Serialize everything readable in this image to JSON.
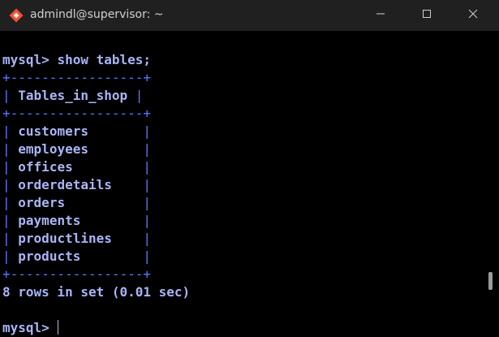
{
  "window": {
    "title": "admindl@supervisor: ~",
    "icon": "git-bash-icon"
  },
  "controls": {
    "minimize": "minimize-icon",
    "maximize": "maximize-icon",
    "close": "close-icon"
  },
  "terminal": {
    "prompt": "mysql>",
    "command": "show tables;",
    "table": {
      "border": "+-----------------+",
      "header": "Tables_in_shop",
      "rows": [
        "customers",
        "employees",
        "offices",
        "orderdetails",
        "orders",
        "payments",
        "productlines",
        "products"
      ]
    },
    "result": "8 rows in set (0.01 sec)",
    "final_prompt": "mysql>"
  },
  "colors": {
    "text": "#a9b4f5",
    "border": "#5a78ff",
    "titlebar": "#202020",
    "background": "#000000"
  }
}
